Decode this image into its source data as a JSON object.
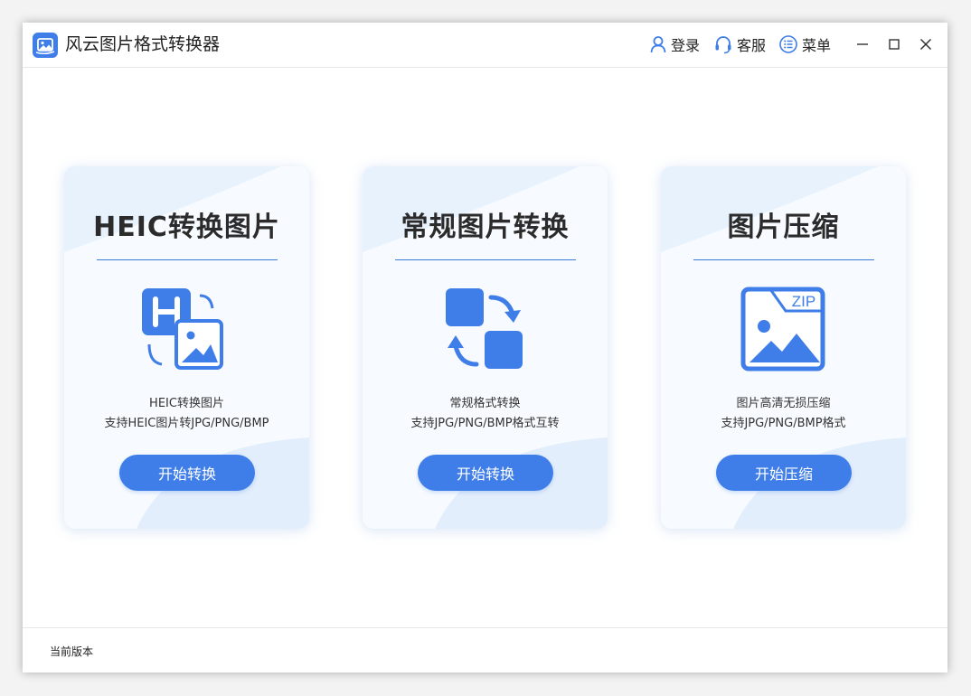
{
  "window": {
    "title": "风云图片格式转换器",
    "actions": {
      "login": "登录",
      "service": "客服",
      "menu": "菜单"
    }
  },
  "cards": [
    {
      "title": "HEIC转换图片",
      "desc1": "HEIC转换图片",
      "desc2": "支持HEIC图片转JPG/PNG/BMP",
      "button": "开始转换",
      "icon": "heic-convert-icon"
    },
    {
      "title": "常规图片转换",
      "desc1": "常规格式转换",
      "desc2": "支持JPG/PNG/BMP格式互转",
      "button": "开始转换",
      "icon": "format-convert-icon"
    },
    {
      "title": "图片压缩",
      "desc1": "图片高清无损压缩",
      "desc2": "支持JPG/PNG/BMP格式",
      "button": "开始压缩",
      "icon": "zip-compress-icon",
      "icon_text": "ZIP"
    }
  ],
  "footer": {
    "version_label": "当前版本"
  },
  "colors": {
    "accent": "#3f7ee8",
    "divider": "#3a7bd5",
    "card_bg": "#f7fbff"
  }
}
